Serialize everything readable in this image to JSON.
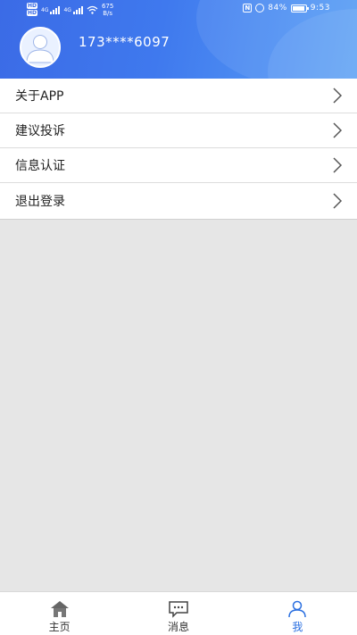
{
  "status_bar": {
    "network_speed_value": "675",
    "network_speed_unit": "B/s",
    "hd_badge": "HD",
    "signal_4g": "4G",
    "battery_percent": "84%",
    "time": "9:53"
  },
  "profile": {
    "phone": "173****6097"
  },
  "menu": {
    "items": [
      {
        "label": "关于APP"
      },
      {
        "label": "建议投诉"
      },
      {
        "label": "信息认证"
      },
      {
        "label": "退出登录"
      }
    ]
  },
  "tabbar": {
    "tabs": [
      {
        "label": "主页"
      },
      {
        "label": "消息"
      },
      {
        "label": "我"
      }
    ],
    "active_color": "#2a6fe0"
  },
  "colors": {
    "header_gradient_start": "#3b6be6",
    "header_gradient_end": "#5aa0f5",
    "page_background": "#e6e6e6"
  }
}
